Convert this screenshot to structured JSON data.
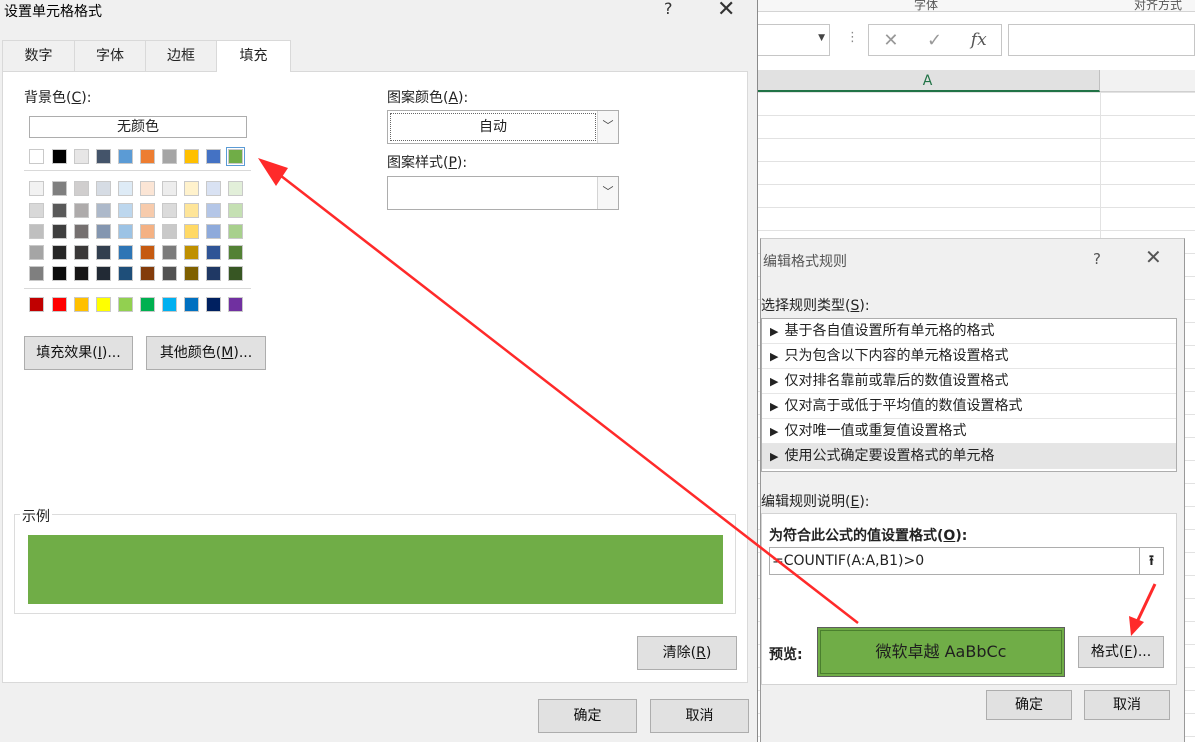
{
  "excel": {
    "ribbon_groups": [
      "字体",
      "对齐方式"
    ],
    "formula_icons": [
      "✕",
      "✓",
      "fx"
    ],
    "column_header": "A"
  },
  "format_cells": {
    "title": "设置单元格格式",
    "help_icon": "?",
    "close_icon": "✕",
    "tabs": [
      "数字",
      "字体",
      "边框",
      "填充"
    ],
    "active_tab": "填充",
    "background_color_label": "背景色(C):",
    "background_color_label_parts": {
      "pre": "背景色(",
      "key": "C",
      "post": "):"
    },
    "no_color_button": "无颜色",
    "palette": {
      "top_row": [
        "#ffffff",
        "#000000",
        "#e7e6e6",
        "#44546a",
        "#5b9bd5",
        "#ed7d31",
        "#a5a5a5",
        "#ffc000",
        "#4472c4",
        "#70ad47"
      ],
      "selected_color": "#70ad47",
      "tint_rows": [
        [
          "#f2f2f2",
          "#7f7f7f",
          "#d0cece",
          "#d6dce4",
          "#deebf6",
          "#fbe5d5",
          "#ededed",
          "#fff2cc",
          "#d9e2f3",
          "#e2efd9"
        ],
        [
          "#d8d8d8",
          "#595959",
          "#aeabab",
          "#adb9ca",
          "#bdd7ee",
          "#f7cbac",
          "#dbdbdb",
          "#fee599",
          "#b4c6e7",
          "#c5e0b3"
        ],
        [
          "#bfbfbf",
          "#3f3f3f",
          "#757070",
          "#8496b0",
          "#9cc3e5",
          "#f4b183",
          "#c9c9c9",
          "#ffd965",
          "#8eaadb",
          "#a8d08d"
        ],
        [
          "#a5a5a5",
          "#262626",
          "#3a3838",
          "#323f4f",
          "#2e75b5",
          "#c55a11",
          "#7b7b7b",
          "#bf9000",
          "#2f5496",
          "#538135"
        ],
        [
          "#7f7f7f",
          "#0c0c0c",
          "#171616",
          "#222a35",
          "#1e4e79",
          "#833c0b",
          "#525252",
          "#7f6000",
          "#1f3864",
          "#375623"
        ]
      ],
      "standard_row": [
        "#c00000",
        "#ff0000",
        "#ffc000",
        "#ffff00",
        "#92d050",
        "#00b050",
        "#00b0f0",
        "#0070c0",
        "#002060",
        "#7030a0"
      ]
    },
    "fill_effects_button": {
      "pre": "填充效果(",
      "key": "I",
      "post": ")..."
    },
    "more_colors_button": {
      "pre": "其他颜色(",
      "key": "M",
      "post": ")..."
    },
    "pattern_color_label": {
      "pre": "图案颜色(",
      "key": "A",
      "post": "):"
    },
    "pattern_color_value": "自动",
    "pattern_style_label": {
      "pre": "图案样式(",
      "key": "P",
      "post": "):"
    },
    "pattern_style_value": "",
    "sample_label": "示例",
    "sample_color": "#70ad47",
    "clear_button": {
      "pre": "清除(",
      "key": "R",
      "post": ")"
    },
    "ok_button": "确定",
    "cancel_button": "取消"
  },
  "edit_rule": {
    "title": "编辑格式规则",
    "help_icon": "?",
    "close_icon": "✕",
    "select_type_label": {
      "pre": "选择规则类型(",
      "key": "S",
      "post": "):"
    },
    "rule_types": [
      "基于各自值设置所有单元格的格式",
      "只为包含以下内容的单元格设置格式",
      "仅对排名靠前或靠后的数值设置格式",
      "仅对高于或低于平均值的数值设置格式",
      "仅对唯一值或重复值设置格式",
      "使用公式确定要设置格式的单元格"
    ],
    "selected_rule_index": 5,
    "edit_desc_label": {
      "pre": "编辑规则说明(",
      "key": "E",
      "post": "):"
    },
    "formula_label": {
      "pre": "为符合此公式的值设置格式(",
      "key": "O",
      "post": "):"
    },
    "formula_value": "=COUNTIF(A:A,B1)>0",
    "ref_button_icon": "⭱",
    "preview_label": "预览:",
    "preview_text": "微软卓越  AaBbCc",
    "preview_color": "#70ad47",
    "format_button": {
      "pre": "格式(",
      "key": "F",
      "post": ")..."
    },
    "ok_button": "确定",
    "cancel_button": "取消"
  },
  "annotation": {
    "arrow_color": "#ff2a2a"
  }
}
